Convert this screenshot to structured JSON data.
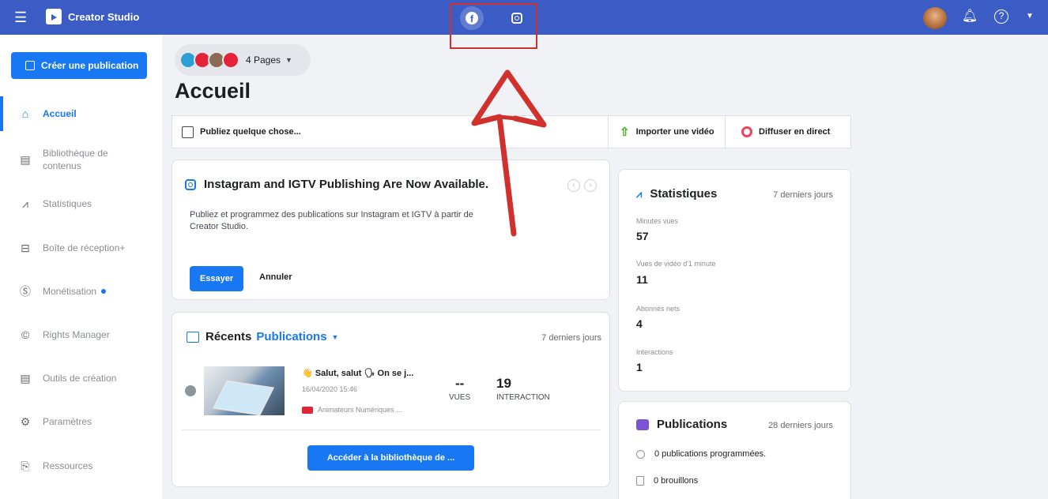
{
  "app": {
    "brand": "Creator Studio"
  },
  "topbar": {
    "platforms": [
      "facebook-icon",
      "instagram-icon"
    ],
    "help": "?"
  },
  "sidebar": {
    "create_label": "Créer une publication",
    "items": [
      {
        "label": "Accueil",
        "icon": "home-icon",
        "active": true
      },
      {
        "label": "Bibliothèque de contenus",
        "icon": "library-icon"
      },
      {
        "label": "Statistiques",
        "icon": "chart-icon"
      },
      {
        "label": "Boîte de réception+",
        "icon": "inbox-icon"
      },
      {
        "label": "Monétisation",
        "icon": "dollar-icon",
        "dot": true
      },
      {
        "label": "Rights Manager",
        "icon": "copyright-icon"
      },
      {
        "label": "Outils de création",
        "icon": "tools-icon"
      },
      {
        "label": "Paramètres",
        "icon": "settings-icon"
      },
      {
        "label": "Ressources",
        "icon": "resources-icon"
      }
    ]
  },
  "header": {
    "pages_label": "4 Pages",
    "title": "Accueil"
  },
  "compose": {
    "placeholder": "Publiez quelque chose...",
    "import_video": "Importer une vidéo",
    "go_live": "Diffuser en direct"
  },
  "promo": {
    "title": "Instagram and IGTV Publishing Are Now Available.",
    "description": "Publiez et programmez des publications sur Instagram et IGTV à partir de Creator Studio.",
    "try_label": "Essayer",
    "cancel_label": "Annuler"
  },
  "recents": {
    "title": "Récents",
    "filter": "Publications",
    "range": "7 derniers jours",
    "post": {
      "title": "👋 Salut, salut 🗣 On se j...",
      "date": "16/04/2020 15:46",
      "page": "Animateurs Numériques ...",
      "views_value": "--",
      "views_label": "VUES",
      "interactions_value": "19",
      "interactions_label": "INTERACTION"
    },
    "library_button": "Accéder à la bibliothèque de ..."
  },
  "stats": {
    "title": "Statistiques",
    "range": "7 derniers jours",
    "rows": [
      {
        "label": "Minutes vues",
        "value": "57"
      },
      {
        "label": "Vues de vidéo d'1 minute",
        "value": "11"
      },
      {
        "label": "Abonnés nets",
        "value": "4"
      },
      {
        "label": "Interactions",
        "value": "1"
      }
    ]
  },
  "publications": {
    "title": "Publications",
    "range": "28 derniers jours",
    "scheduled": "0 publications programmées.",
    "drafts": "0 brouillons"
  },
  "colors": {
    "topbar": "#3b5cc4",
    "accent": "#1877f2",
    "annotation": "#d0312d"
  }
}
